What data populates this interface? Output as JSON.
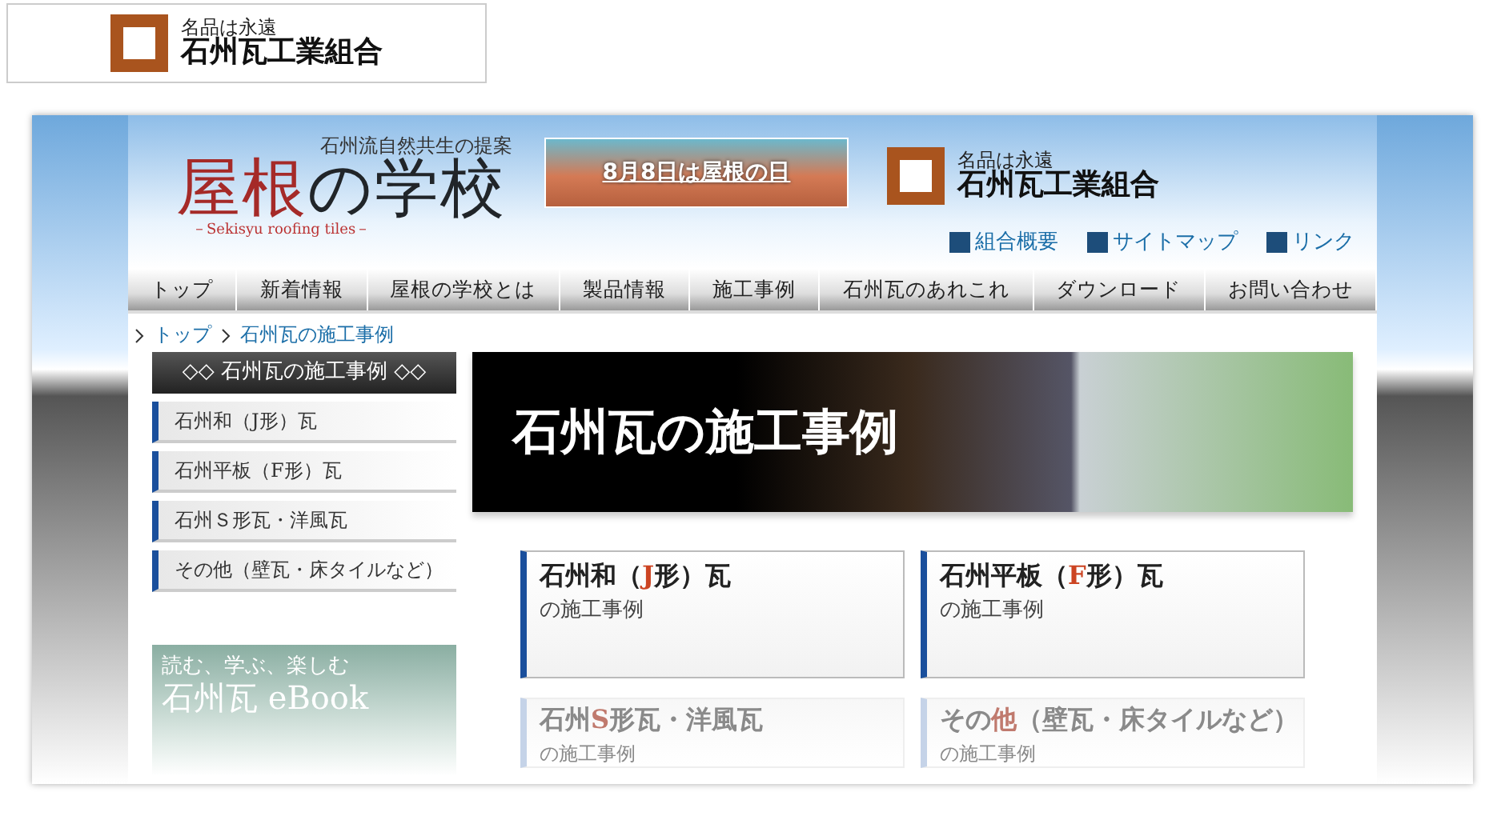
{
  "top_logo": {
    "tagline": "名品は永遠",
    "name": "石州瓦工業組合"
  },
  "header": {
    "subtitle": "石州流自然共生の提案",
    "title": [
      {
        "text": "屋根",
        "accent": true
      },
      {
        "text": "の",
        "accent": false
      },
      {
        "text": "学校",
        "accent": false
      }
    ],
    "english": "－Sekisyu roofing tiles－",
    "banner": "8月8日は屋根の日",
    "union_logo": {
      "tagline": "名品は永遠",
      "name": "石州瓦工業組合"
    },
    "links": [
      "組合概要",
      "サイトマップ",
      "リンク"
    ]
  },
  "nav": [
    "トップ",
    "新着情報",
    "屋根の学校とは",
    "製品情報",
    "施工事例",
    "石州瓦のあれこれ",
    "ダウンロード",
    "お問い合わせ"
  ],
  "breadcrumb": [
    "トップ",
    "石州瓦の施工事例"
  ],
  "sidebar": {
    "heading": "◇◇ 石州瓦の施工事例 ◇◇",
    "items": [
      "石州和（J形）瓦",
      "石州平板（F形）瓦",
      "石州Ｓ形瓦・洋風瓦",
      "その他（壁瓦・床タイルなど）"
    ],
    "ebook": {
      "tagline": "読む、学ぶ、楽しむ",
      "title": "石州瓦 eBook"
    }
  },
  "hero": {
    "title": "石州瓦の施工事例"
  },
  "cards": [
    {
      "faded": false,
      "title": [
        {
          "text": "石州和（",
          "accent": false
        },
        {
          "text": "J",
          "accent": true
        },
        {
          "text": "形）瓦",
          "accent": false
        }
      ],
      "subtitle": "の施工事例"
    },
    {
      "faded": false,
      "title": [
        {
          "text": "石州平板（",
          "accent": false
        },
        {
          "text": "F",
          "accent": true
        },
        {
          "text": "形）瓦",
          "accent": false
        }
      ],
      "subtitle": "の施工事例"
    },
    {
      "faded": true,
      "title": [
        {
          "text": "石州",
          "accent": false
        },
        {
          "text": "S",
          "accent": true
        },
        {
          "text": "形瓦・洋風瓦",
          "accent": false
        }
      ],
      "subtitle": "の施工事例"
    },
    {
      "faded": true,
      "title": [
        {
          "text": "その",
          "accent": false
        },
        {
          "text": "他",
          "accent": true
        },
        {
          "text": "（壁瓦・床タイルなど）",
          "accent": false
        }
      ],
      "subtitle": "の施工事例"
    }
  ]
}
